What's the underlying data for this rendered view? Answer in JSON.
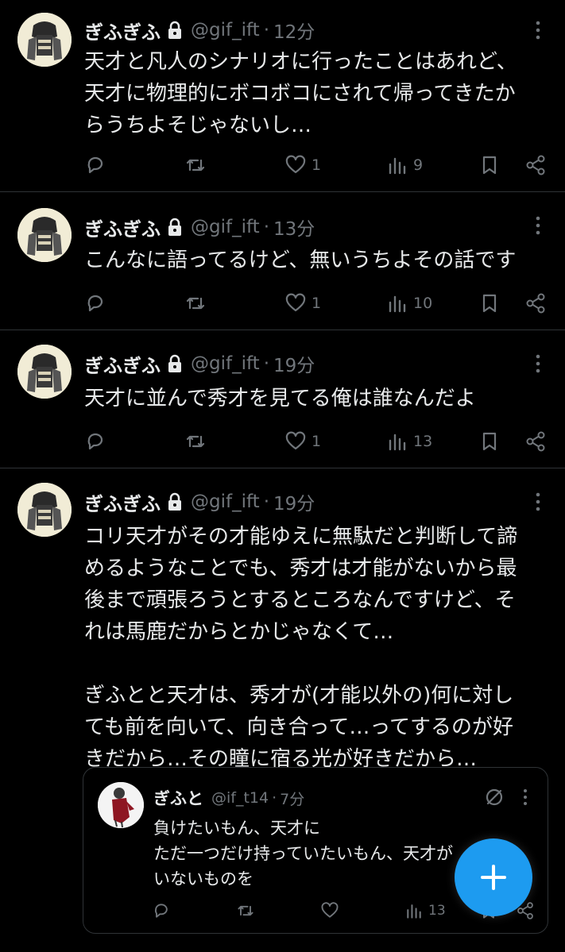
{
  "accent": "#1d9bf0",
  "tweets": [
    {
      "name": "ぎふぎふ",
      "handle": "@gif_ift",
      "time": "12分",
      "lines": [
        "天才と凡人のシナリオに行ったことはあれど、",
        "天才に物理的にボコボコにされて帰ってきたか",
        "らうちよそじゃないし…"
      ],
      "likes": "1",
      "views": "9"
    },
    {
      "name": "ぎふぎふ",
      "handle": "@gif_ift",
      "time": "13分",
      "lines": [
        "こんなに語ってるけど、無いうちよその話です"
      ],
      "likes": "1",
      "views": "10"
    },
    {
      "name": "ぎふぎふ",
      "handle": "@gif_ift",
      "time": "19分",
      "lines": [
        "天才に並んで秀才を見てる俺は誰なんだよ"
      ],
      "likes": "1",
      "views": "13"
    },
    {
      "name": "ぎふぎふ",
      "handle": "@gif_ift",
      "time": "19分",
      "lines": [
        "コリ天才がその才能ゆえに無駄だと判断して諦",
        "めるようなことでも、秀才は才能がないから最",
        "後まで頑張ろうとするところなんですけど、そ",
        "れは馬鹿だからとかじゃなくて…",
        "",
        "ぎふとと天才は、秀才が(才能以外の)何に対し",
        "ても前を向いて、向き合って…ってするのが好",
        "きだから…その瞳に宿る光が好きだから…"
      ],
      "quote": {
        "name": "ぎふと",
        "handle": "@if_t14",
        "time": "7分",
        "lines": [
          "負けたいもん、天才に",
          "ただ一つだけ持っていたいもん、天才が",
          "いないものを"
        ],
        "views": "13"
      }
    }
  ]
}
